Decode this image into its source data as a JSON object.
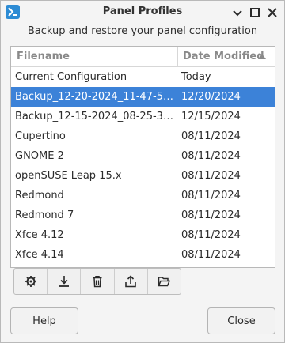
{
  "window": {
    "title": "Panel Profiles"
  },
  "subtitle": "Backup and restore your panel configuration",
  "table": {
    "columns": {
      "name": "Filename",
      "date": "Date Modified"
    },
    "sort": "descending",
    "rows": [
      {
        "name": "Current Configuration",
        "date": "Today",
        "selected": false
      },
      {
        "name": "Backup_12-20-2024_11-47-56_...",
        "date": "12/20/2024",
        "selected": true
      },
      {
        "name": "Backup_12-15-2024_08-25-30_...",
        "date": "12/15/2024",
        "selected": false
      },
      {
        "name": "Cupertino",
        "date": "08/11/2024",
        "selected": false
      },
      {
        "name": "GNOME 2",
        "date": "08/11/2024",
        "selected": false
      },
      {
        "name": "openSUSE Leap 15.x",
        "date": "08/11/2024",
        "selected": false
      },
      {
        "name": "Redmond",
        "date": "08/11/2024",
        "selected": false
      },
      {
        "name": "Redmond 7",
        "date": "08/11/2024",
        "selected": false
      },
      {
        "name": "Xfce 4.12",
        "date": "08/11/2024",
        "selected": false
      },
      {
        "name": "Xfce 4.14",
        "date": "08/11/2024",
        "selected": false
      }
    ]
  },
  "toolbar": {
    "icons": [
      "settings-icon",
      "download-icon",
      "trash-icon",
      "export-icon",
      "folder-open-icon"
    ]
  },
  "buttons": {
    "help": "Help",
    "close": "Close"
  },
  "colors": {
    "selection": "#3c82d8",
    "app_icon": "#2c8bd4"
  }
}
